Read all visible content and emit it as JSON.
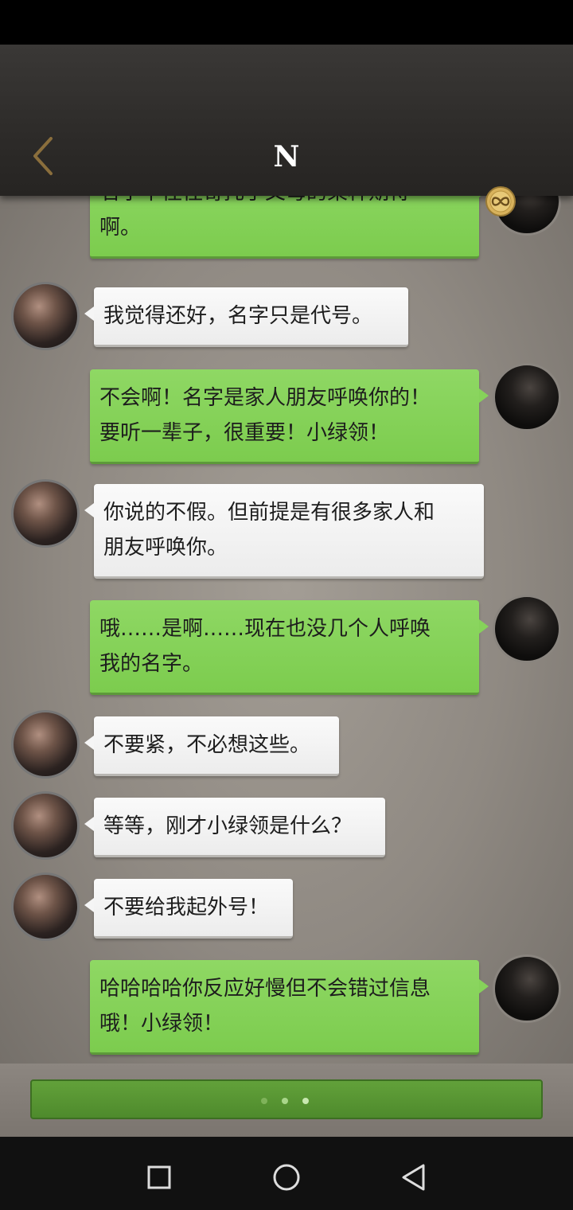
{
  "header": {
    "title": "N",
    "back_icon": "chevron-left-icon",
    "coin_icon": "infinity-coin-icon",
    "accent_color": "#c29a4a"
  },
  "messages": [
    {
      "side": "me",
      "lines": [
        "名字中往往寄托了父母的某种期待",
        "啊。"
      ]
    },
    {
      "side": "other",
      "lines": [
        "我觉得还好，名字只是代号。"
      ]
    },
    {
      "side": "me",
      "lines": [
        "不会啊！名字是家人朋友呼唤你的！",
        "要听一辈子，很重要！小绿领！"
      ]
    },
    {
      "side": "other",
      "lines": [
        "你说的不假。但前提是有很多家人和",
        "朋友呼唤你。"
      ]
    },
    {
      "side": "me",
      "lines": [
        "哦……是啊……现在也没几个人呼唤",
        "我的名字。"
      ]
    },
    {
      "side": "other",
      "lines": [
        "不要紧，不必想这些。"
      ]
    },
    {
      "side": "other",
      "lines": [
        "等等，刚才小绿领是什么？"
      ]
    },
    {
      "side": "other",
      "lines": [
        "不要给我起外号！"
      ]
    },
    {
      "side": "me",
      "lines": [
        "哈哈哈哈你反应好慢但不会错过信息",
        "哦！小绿领！"
      ]
    }
  ],
  "input": {
    "typing_indicator_dots": 3,
    "color": "#5a9a34"
  },
  "nav": {
    "recent_icon": "square-recents-icon",
    "home_icon": "circle-home-icon",
    "back_icon": "triangle-back-icon"
  }
}
